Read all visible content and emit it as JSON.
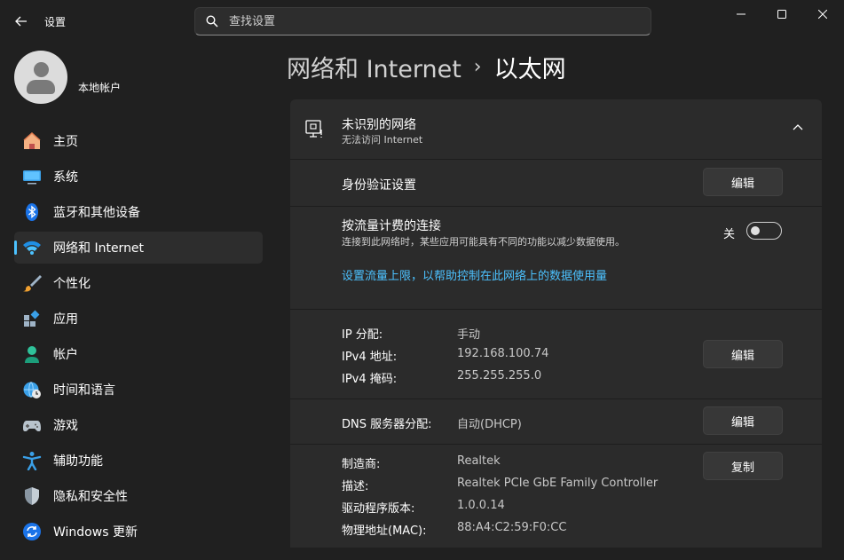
{
  "window": {
    "title": "设置",
    "controls": {
      "minimize": "minimize-icon",
      "maximize": "maximize-icon",
      "close": "close-icon"
    }
  },
  "search": {
    "placeholder": "查找设置",
    "value": ""
  },
  "user": {
    "name": "本地帐户"
  },
  "nav": {
    "items": [
      {
        "label": "主页",
        "icon": "home-icon"
      },
      {
        "label": "系统",
        "icon": "monitor-icon"
      },
      {
        "label": "蓝牙和其他设备",
        "icon": "bluetooth-icon"
      },
      {
        "label": "网络和 Internet",
        "icon": "wifi-icon",
        "active": true
      },
      {
        "label": "个性化",
        "icon": "brush-icon"
      },
      {
        "label": "应用",
        "icon": "apps-icon"
      },
      {
        "label": "帐户",
        "icon": "person-icon"
      },
      {
        "label": "时间和语言",
        "icon": "globe-clock-icon"
      },
      {
        "label": "游戏",
        "icon": "gamepad-icon"
      },
      {
        "label": "辅助功能",
        "icon": "accessibility-icon"
      },
      {
        "label": "隐私和安全性",
        "icon": "shield-icon"
      },
      {
        "label": "Windows 更新",
        "icon": "update-icon"
      }
    ]
  },
  "breadcrumb": {
    "parent": "网络和 Internet",
    "separator": "›",
    "current": "以太网"
  },
  "network": {
    "name": "未识别的网络",
    "status": "无法访问 Internet"
  },
  "auth": {
    "label": "身份验证设置",
    "button": "编辑"
  },
  "metered": {
    "title": "按流量计费的连接",
    "description": "连接到此网络时，某些应用可能具有不同的功能以减少数据使用。",
    "toggle_state": "关",
    "toggle_on": false,
    "link": "设置流量上限，以帮助控制在此网络上的数据使用量"
  },
  "ip": {
    "rows": [
      {
        "key": "IP 分配:",
        "value": "手动"
      },
      {
        "key": "IPv4 地址:",
        "value": "192.168.100.74"
      },
      {
        "key": "IPv4 掩码:",
        "value": "255.255.255.0"
      }
    ],
    "button": "编辑"
  },
  "dns": {
    "key": "DNS 服务器分配:",
    "value": "自动(DHCP)",
    "button": "编辑"
  },
  "adapter": {
    "rows": [
      {
        "key": "制造商:",
        "value": "Realtek"
      },
      {
        "key": "描述:",
        "value": "Realtek PCIe GbE Family Controller"
      },
      {
        "key": "驱动程序版本:",
        "value": "1.0.0.14"
      },
      {
        "key": "物理地址(MAC):",
        "value": "88:A4:C2:59:F0:CC"
      }
    ],
    "button": "复制"
  },
  "colors": {
    "accent": "#4cc2ff",
    "background": "#202020",
    "card": "#2b2b2b"
  }
}
